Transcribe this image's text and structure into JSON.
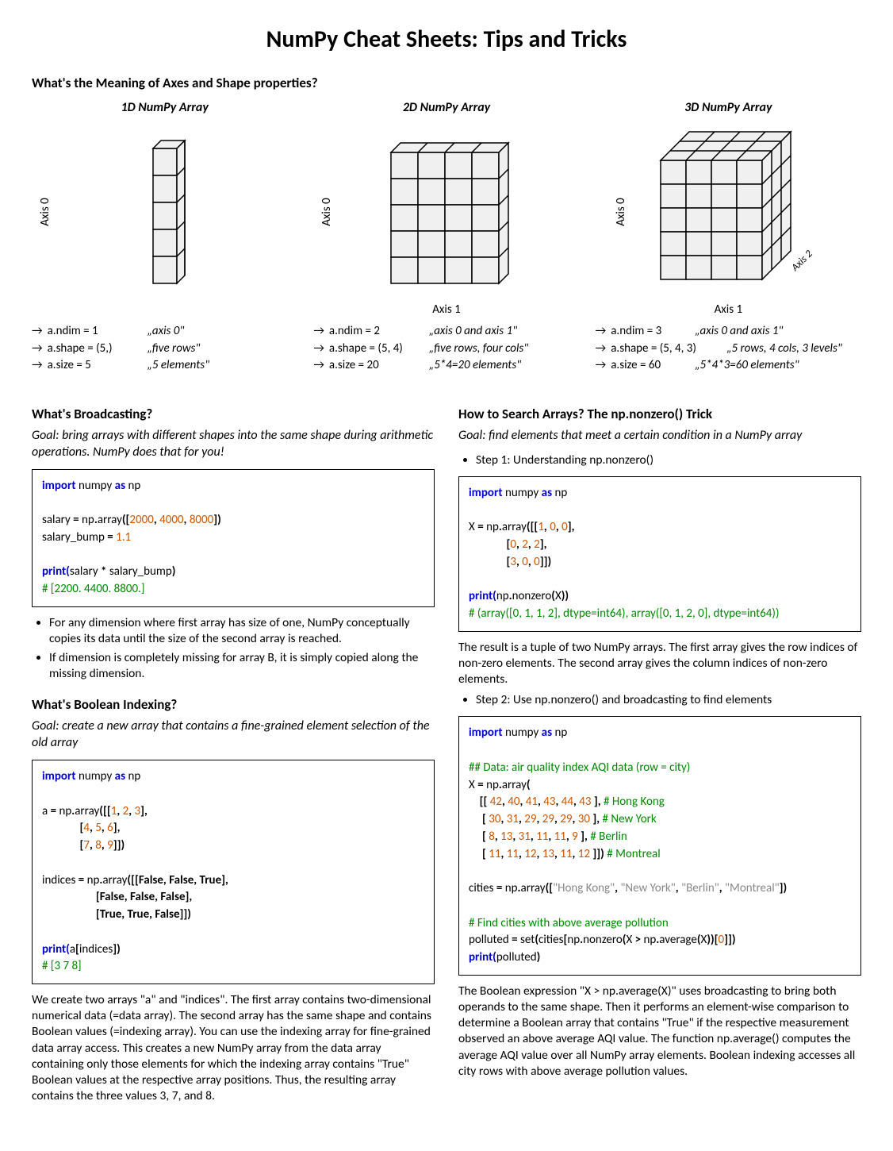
{
  "title": "NumPy Cheat Sheets: Tips and Tricks",
  "axes_section": {
    "heading": "What's the Meaning of Axes and Shape properties?",
    "arrays": [
      {
        "title": "1D NumPy Array",
        "axis0": "Axis 0",
        "axis1": "",
        "props": [
          {
            "k": "a.ndim = 1",
            "note": "„axis 0\""
          },
          {
            "k": "a.shape = (5,)",
            "note": "„five rows\""
          },
          {
            "k": "a.size = 5",
            "note": "„5 elements\""
          }
        ]
      },
      {
        "title": "2D NumPy Array",
        "axis0": "Axis 0",
        "axis1": "Axis 1",
        "props": [
          {
            "k": "a.ndim = 2",
            "note": "„axis 0 and axis 1\""
          },
          {
            "k": "a.shape = (5, 4)",
            "note": "„five rows, four cols\""
          },
          {
            "k": "a.size = 20",
            "note": "„5*4=20 elements\""
          }
        ]
      },
      {
        "title": "3D NumPy Array",
        "axis0": "Axis 0",
        "axis1": "Axis 1",
        "axis2": "Axis 2",
        "props": [
          {
            "k": "a.ndim = 3",
            "note": "„axis 0 and axis 1\""
          },
          {
            "k": "a.shape = (5, 4, 3)",
            "note": "„5 rows, 4 cols, 3 levels\""
          },
          {
            "k": "a.size = 60",
            "note": "„5*4*3=60 elements\""
          }
        ]
      }
    ]
  },
  "broadcasting": {
    "heading": "What's Broadcasting?",
    "goal": "Goal: bring arrays with different shapes into the same shape during arithmetic operations. NumPy does that for you!",
    "bullets": [
      "For any dimension where first array has size of one, NumPy conceptually copies its data until the size of the second array is reached.",
      "If dimension is completely missing for array B, it is simply copied along the missing dimension."
    ]
  },
  "boolean_indexing": {
    "heading": "What's Boolean Indexing?",
    "goal": "Goal: create a new array that contains a fine-grained element selection of the old array",
    "explain": "We create two arrays \"a\" and \"indices\". The first array contains two-dimensional numerical data (=data array). The second array has the same shape and contains Boolean values (=indexing array). You can use the indexing array for fine-grained data array access. This creates a new NumPy array from the data array containing only those elements for which the indexing array contains \"True\" Boolean values at the respective array positions. Thus, the resulting array contains the three values 3, 7, and 8."
  },
  "nonzero": {
    "heading": "How to Search Arrays? The np.nonzero() Trick",
    "goal": "Goal: find elements that meet a certain condition in a NumPy array",
    "step1": "Step 1: Understanding np.nonzero()",
    "step1_explain": "The result is a tuple of two NumPy arrays. The first array gives the row indices of non-zero elements. The second array gives the column indices of non-zero elements.",
    "step2": "Step 2: Use np.nonzero() and broadcasting to find elements",
    "step2_explain": "The Boolean expression \"X > np.average(X)\" uses broadcasting to bring both operands to the same shape. Then it performs an element-wise comparison to determine a Boolean array that contains \"True\" if the respective measurement observed an above average AQI value. The function np.average() computes the average AQI value over all NumPy array elements. Boolean indexing accesses all city rows with above average pollution values."
  }
}
